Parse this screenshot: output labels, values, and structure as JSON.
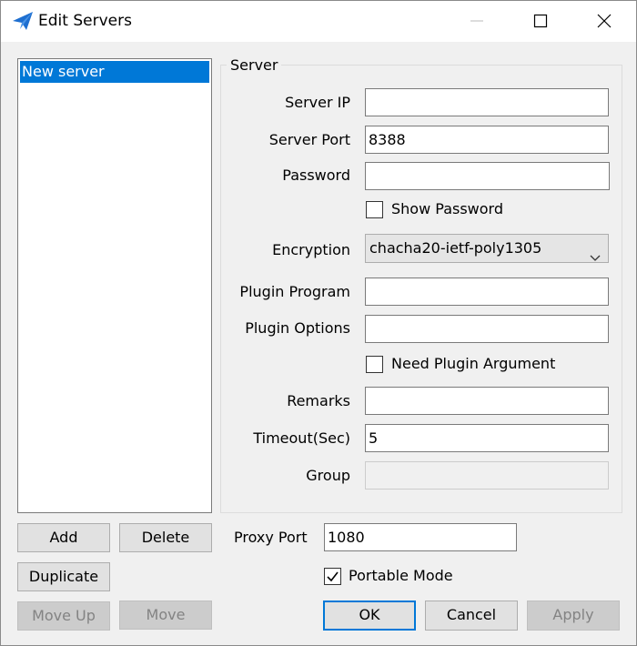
{
  "window": {
    "title": "Edit Servers"
  },
  "icons": {
    "app": "paper-plane-icon",
    "minimize": "minimize-icon",
    "maximize": "maximize-icon",
    "close": "close-icon",
    "dropdown": "chevron-down-icon",
    "check": "checkmark-icon"
  },
  "server_list": {
    "items": [
      "New server"
    ],
    "selected_index": 0
  },
  "server": {
    "group_title": "Server",
    "ip": {
      "label": "Server IP",
      "value": ""
    },
    "port": {
      "label": "Server Port",
      "value": "8388"
    },
    "password": {
      "label": "Password",
      "value": ""
    },
    "show_password": {
      "label": "Show Password",
      "checked": false
    },
    "encryption": {
      "label": "Encryption",
      "value": "chacha20-ietf-poly1305"
    },
    "plugin_program": {
      "label": "Plugin Program",
      "value": ""
    },
    "plugin_options": {
      "label": "Plugin Options",
      "value": ""
    },
    "need_plugin_argument": {
      "label": "Need Plugin Argument",
      "checked": false
    },
    "remarks": {
      "label": "Remarks",
      "value": ""
    },
    "timeout": {
      "label": "Timeout(Sec)",
      "value": "5"
    },
    "group": {
      "label": "Group",
      "value": ""
    }
  },
  "buttons": {
    "add": "Add",
    "delete": "Delete",
    "duplicate": "Duplicate",
    "move_up": "Move Up",
    "move_down": "Move",
    "ok": "OK",
    "cancel": "Cancel",
    "apply": "Apply"
  },
  "proxy_port": {
    "label": "Proxy Port",
    "value": "1080"
  },
  "portable_mode": {
    "label": "Portable Mode",
    "checked": true
  },
  "colors": {
    "selection": "#0078d7",
    "accent": "#0078d7",
    "dialog_bg": "#f0f0f0"
  }
}
